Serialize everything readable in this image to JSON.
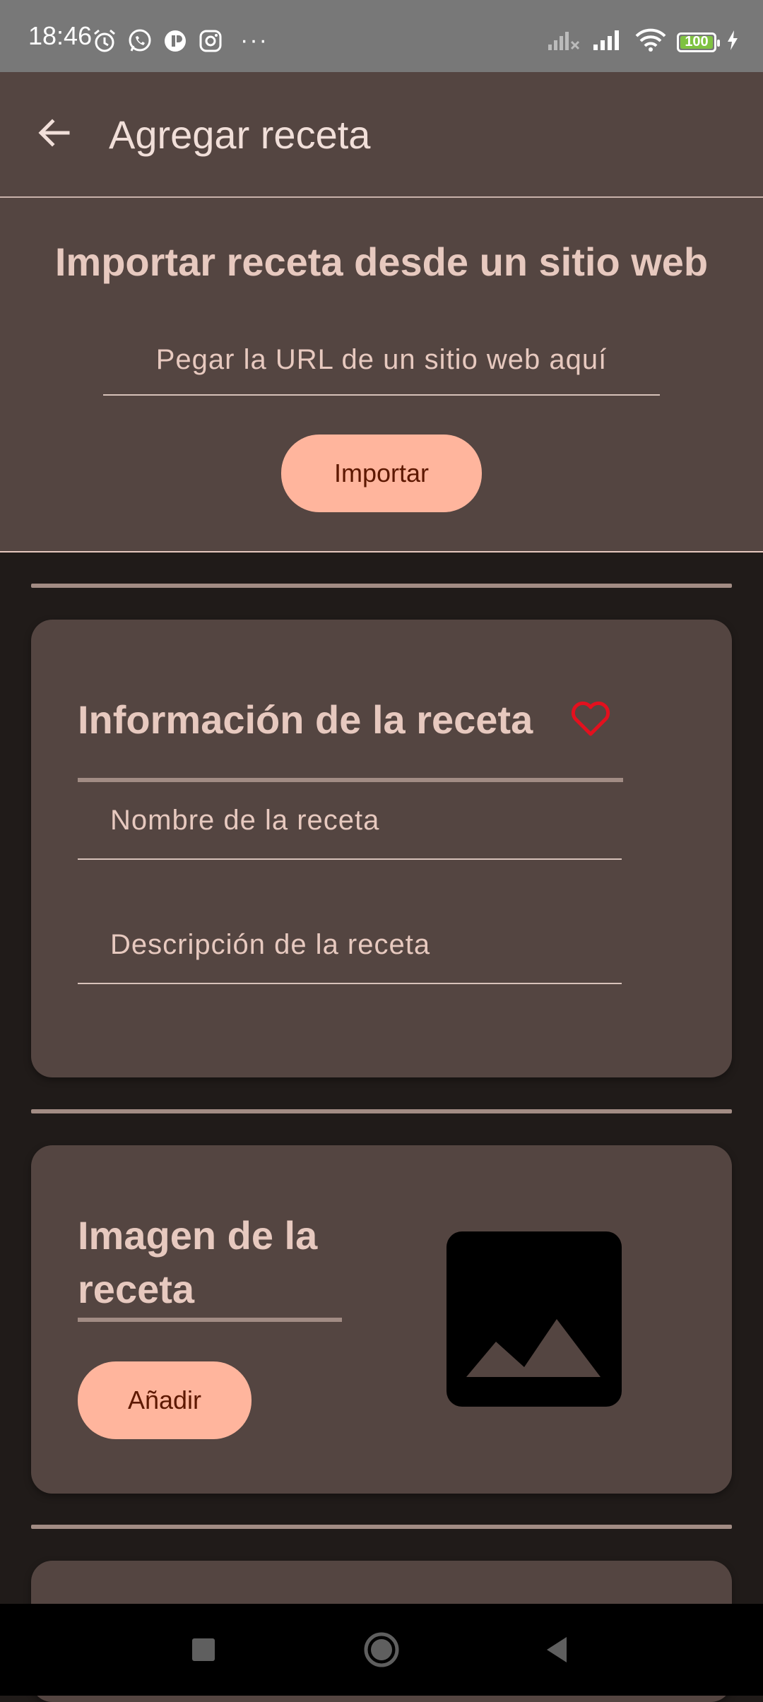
{
  "status_bar": {
    "time": "18:46",
    "left_icons": [
      "alarm-icon",
      "whatsapp-icon",
      "app-icon",
      "instagram-icon"
    ],
    "overflow": "···",
    "battery_level": "100",
    "right_icons": [
      "signal-off-icon",
      "signal-icon",
      "wifi-icon",
      "battery-icon",
      "charging-icon"
    ]
  },
  "app_bar": {
    "title": "Agregar receta",
    "back_icon": "arrow-back-icon"
  },
  "import_section": {
    "title": "Importar receta desde un sitio web",
    "url_placeholder": "Pegar la URL de un sitio web aquí",
    "url_value": "",
    "import_button": "Importar"
  },
  "info_card": {
    "title": "Información de la receta",
    "favorite_icon": "heart-outline-icon",
    "name_placeholder": "Nombre de la receta",
    "name_value": "",
    "description_placeholder": "Descripción de la receta",
    "description_value": ""
  },
  "image_card": {
    "title": "Imagen de la receta",
    "add_button": "Añadir",
    "placeholder_icon": "image-placeholder-icon"
  },
  "colors": {
    "surface": "#544541",
    "background": "#201b19",
    "primary_button": "#ffb59d",
    "on_primary_button": "#5d1800",
    "text": "#e7c9bf",
    "heart": "#e3101e"
  },
  "nav_bar": {
    "buttons": [
      "recents-icon",
      "home-icon",
      "back-icon"
    ]
  }
}
